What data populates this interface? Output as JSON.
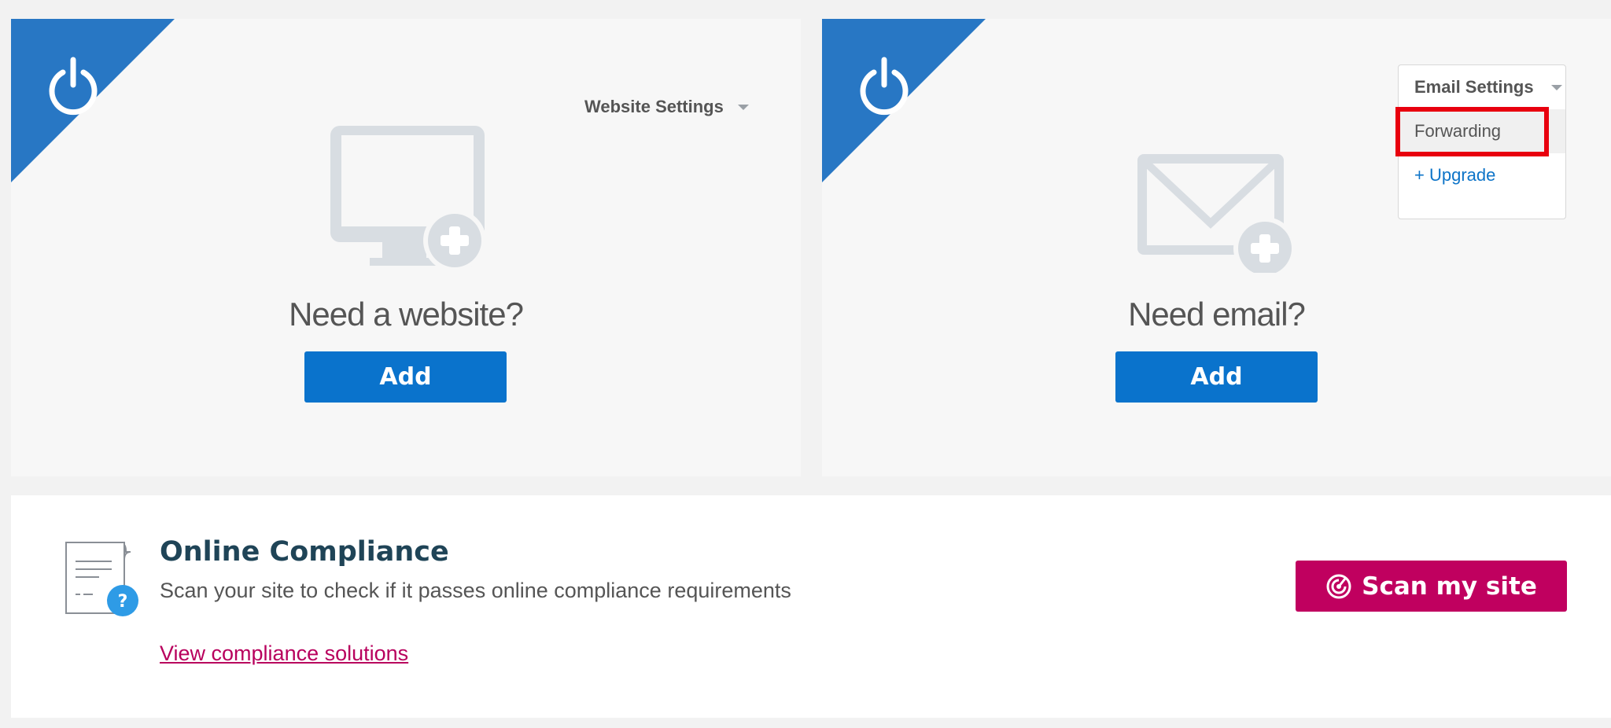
{
  "website_card": {
    "settings_label": "Website Settings",
    "heading": "Need a website?",
    "add_label": "Add",
    "icons": {
      "corner": "power-icon",
      "hero": "monitor-plus-icon",
      "caret": "caret-down-icon"
    }
  },
  "email_card": {
    "settings_label": "Email Settings",
    "heading": "Need email?",
    "add_label": "Add",
    "dropdown": {
      "items": [
        {
          "label": "Forwarding"
        },
        {
          "label": "+ Upgrade"
        }
      ]
    },
    "icons": {
      "corner": "power-icon",
      "hero": "envelope-plus-icon",
      "caret": "caret-down-icon"
    }
  },
  "compliance": {
    "title": "Online Compliance",
    "description": "Scan your site to check if it passes online compliance requirements",
    "link_label": "View compliance solutions",
    "scan_label": "Scan my site",
    "icons": {
      "doc": "document-question-icon",
      "scan": "radar-icon"
    }
  },
  "colors": {
    "corner_blue": "#2877c4",
    "button_blue": "#0a73cc",
    "scan_magenta": "#c0005f",
    "link_magenta": "#b8005d",
    "highlight_red": "#e8000e",
    "title_navy": "#1f4457"
  }
}
